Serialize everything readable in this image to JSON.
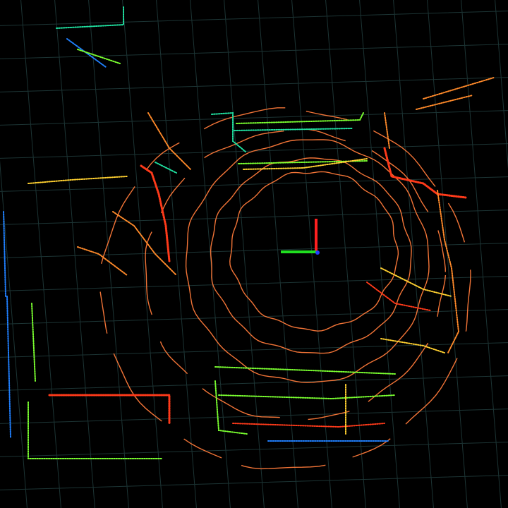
{
  "viewer": {
    "view": "lidar-point-cloud-top-down",
    "background_color": "#000000",
    "grid_color": "#1f3a3a",
    "colormap": [
      "#ff3a1a",
      "#ff8a2a",
      "#ffd030",
      "#7aff30",
      "#20e0a0",
      "#2080ff"
    ]
  },
  "frame_axes": {
    "x_axis_color": "#ff2020",
    "y_axis_color": "#20e020",
    "z_axis_color": "#2040ff"
  },
  "scan_rings": {
    "color": "#ff7a3a",
    "count": 5
  }
}
